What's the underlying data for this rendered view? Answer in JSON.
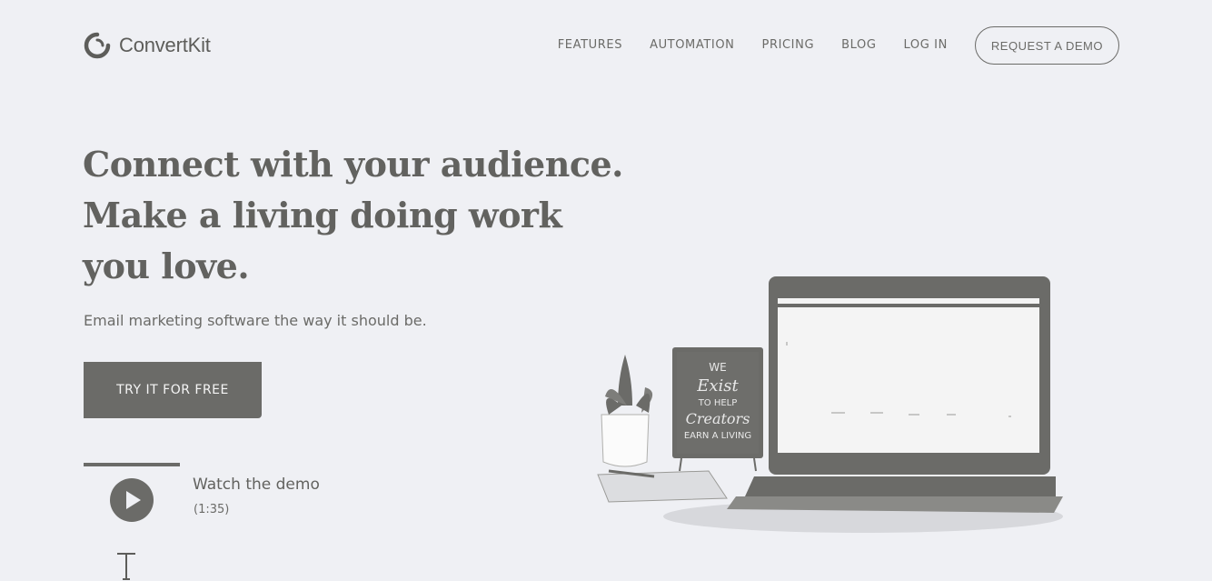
{
  "brand": {
    "name": "ConvertKit"
  },
  "nav": {
    "items": [
      {
        "label": "FEATURES"
      },
      {
        "label": "AUTOMATION"
      },
      {
        "label": "PRICING"
      },
      {
        "label": "BLOG"
      },
      {
        "label": "LOG IN"
      }
    ],
    "demo_button": "REQUEST A DEMO"
  },
  "hero": {
    "lines": [
      "Connect with your audience.",
      "Make a living doing work",
      "you love."
    ],
    "subtitle": "Email marketing software the way it should be.",
    "cta": "TRY IT FOR FREE"
  },
  "video": {
    "title": "Watch the demo",
    "duration": "(1:35)"
  },
  "illustration": {
    "sign_lines": [
      "WE",
      "Exist",
      "TO HELP",
      "Creators",
      "EARN A LIVING"
    ]
  },
  "colors": {
    "background": "#eff0f4",
    "text": "#6b6b68",
    "button": "#6b6b68"
  }
}
